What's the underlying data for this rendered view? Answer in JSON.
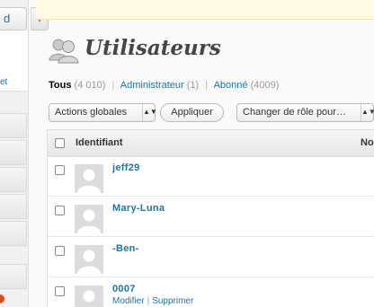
{
  "sidebar": {
    "top_label": "d",
    "link_label": "et",
    "arrow": "▾"
  },
  "header": {
    "title": "Utilisateurs",
    "icon": "users-icon"
  },
  "filters": {
    "all_label": "Tous",
    "all_count": "(4 010)",
    "admin_label": "Administrateur",
    "admin_count": "(1)",
    "sub_label": "Abonné",
    "sub_count": "(4009)",
    "separator": "|"
  },
  "tablenav": {
    "bulk_actions": "Actions globales",
    "apply": "Appliquer",
    "change_role": "Changer de rôle pour…",
    "arrows": "▲▼"
  },
  "table": {
    "columns": [
      "Identifiant",
      "No"
    ],
    "rows": [
      {
        "username": "jeff29"
      },
      {
        "username": "Mary-Luna"
      },
      {
        "username": "-Ben-"
      },
      {
        "username": "0007",
        "actions": [
          "Modifier",
          "Supprimer"
        ]
      }
    ]
  },
  "colors": {
    "link": "#21759b",
    "notice": "#fffbe4",
    "badge": "#d54e21"
  }
}
